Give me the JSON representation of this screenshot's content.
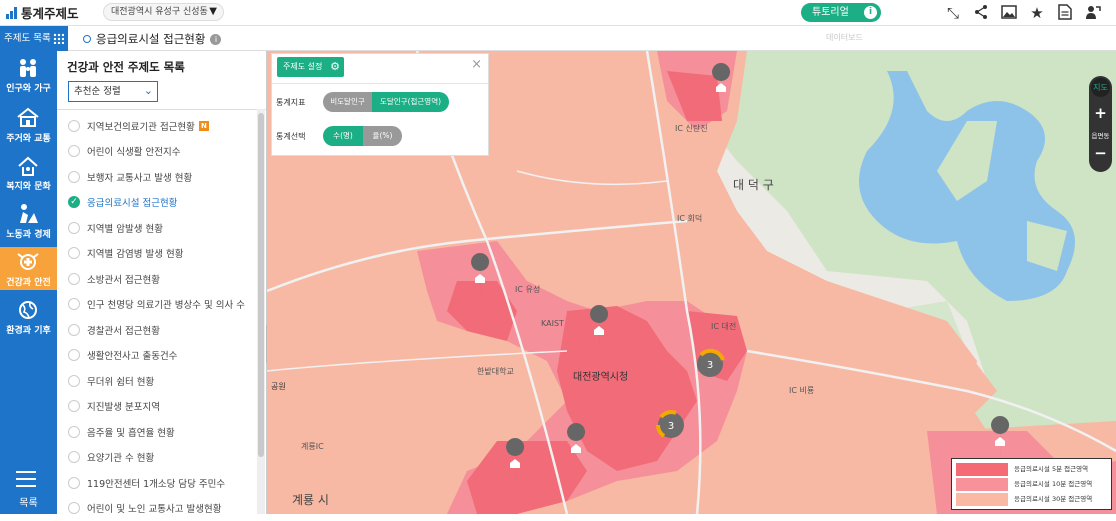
{
  "app": {
    "title": "통계주제도"
  },
  "region": {
    "label": "대전광역시 유성구 신성동"
  },
  "tutorial": {
    "label": "튜토리얼",
    "info_icon": "i"
  },
  "top_icons": [
    "collapse-icon",
    "share-icon",
    "image-icon",
    "star-icon",
    "document-icon",
    "user-icon"
  ],
  "menu": {
    "label": "주제도 목록"
  },
  "page": {
    "title": "응급의료시설 접근현황",
    "ghost_text": "데이터보드"
  },
  "sidenav": {
    "items": [
      {
        "label": "인구와 가구",
        "icon": "family-icon"
      },
      {
        "label": "주거와 교통",
        "icon": "house-icon"
      },
      {
        "label": "복지와 문화",
        "icon": "welfare-icon"
      },
      {
        "label": "노동과 경제",
        "icon": "worker-icon"
      },
      {
        "label": "건강과 안전",
        "icon": "health-icon",
        "active": true
      },
      {
        "label": "환경과 기후",
        "icon": "environment-icon"
      }
    ],
    "toc_label": "목록"
  },
  "list_panel": {
    "title": "건강과 안전 주제도 목록",
    "sort": {
      "selected": "추천순 정렬"
    },
    "items": [
      {
        "label": "지역보건의료기관 접근현황",
        "badge": "N"
      },
      {
        "label": "어린이 식생활 안전지수"
      },
      {
        "label": "보행자 교통사고 발생 현황"
      },
      {
        "label": "응급의료시설 접근현황",
        "selected": true
      },
      {
        "label": "지역별 암발생 현황"
      },
      {
        "label": "지역별 감염병 발생 현황"
      },
      {
        "label": "소방관서 접근현황"
      },
      {
        "label": "인구 천명당 의료기관 병상수 및 의사 수"
      },
      {
        "label": "경찰관서 접근현황"
      },
      {
        "label": "생활안전사고 출동건수"
      },
      {
        "label": "무더위 쉼터 현황"
      },
      {
        "label": "지진발생 분포지역"
      },
      {
        "label": "음주율 및 흡연율 현황"
      },
      {
        "label": "요양기관 수 현황"
      },
      {
        "label": "119안전센터 1개소당 담당 주민수"
      },
      {
        "label": "어린이 및 노인 교통사고 발생현황"
      }
    ]
  },
  "settings": {
    "button_label": "주제도 설정",
    "close_icon": "×",
    "indicator": {
      "label": "통계지표",
      "options": [
        "비도달인구",
        "도달인구(접근영역)"
      ],
      "selected": 1
    },
    "stat": {
      "label": "통계선택",
      "options": [
        "수(명)",
        "율(%)"
      ],
      "selected": 0
    }
  },
  "legend": {
    "items": [
      {
        "label": "응급의료시설 5분 접근영역",
        "color": "#f46a75"
      },
      {
        "label": "응급의료시설 10분 접근영역",
        "color": "#f7919a"
      },
      {
        "label": "응급의료시설 30분 접근영역",
        "color": "#f9b9a3"
      }
    ]
  },
  "zoom": {
    "level_label": "읍면동",
    "plus": "+",
    "minus": "−",
    "badge": "지도"
  },
  "clusters": [
    {
      "count": "3"
    },
    {
      "count": "3"
    }
  ],
  "map_labels": {
    "daedeok": "대 덕 구",
    "daejeon_city": "대전광역시청",
    "gyeryong": "계룡 시",
    "hanbat": "한밭대학교",
    "kaist": "KAIST",
    "yuseong_ic": "IC 유성",
    "daejeon_ic": "IC 대전",
    "sintanjin_ic": "IC 신탄진",
    "hoedeok_ic": "IC 회덕",
    "biryong_ic": "IC 비룡",
    "gyeryong_ic": "계룡IC",
    "park": "공원"
  }
}
